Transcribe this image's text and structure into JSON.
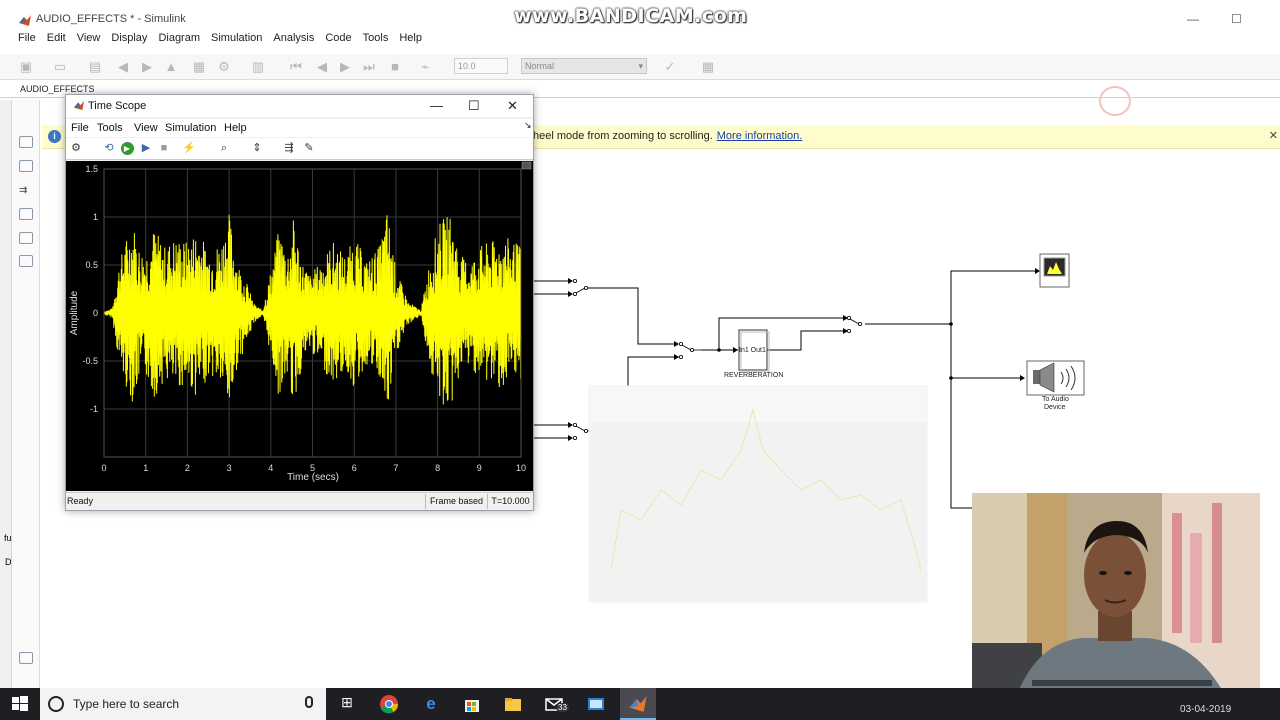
{
  "simulink": {
    "title": "AUDIO_EFFECTS * - Simulink",
    "menu": [
      "File",
      "Edit",
      "View",
      "Display",
      "Diagram",
      "Simulation",
      "Analysis",
      "Code",
      "Tools",
      "Help"
    ],
    "toolbar": {
      "stop_time": "10.0",
      "sim_mode": "Normal"
    },
    "model_tab": "AUDIO_EFFECTS",
    "info_bar": {
      "text": "heel mode from zooming to scrolling.",
      "link": "More information."
    },
    "blocks": {
      "reverb_ports": "In1 Out1",
      "reverb_label": "REVERBERATION",
      "audio_device_label_1": "To Audio",
      "audio_device_label_2": "Device"
    },
    "left_strip_labels": [
      "fu",
      "D"
    ]
  },
  "scope": {
    "title": "Time Scope",
    "menu": [
      "File",
      "Tools",
      "View",
      "Simulation",
      "Help"
    ],
    "status": {
      "ready": "Ready",
      "mode": "Frame based",
      "time": "T=10.000"
    }
  },
  "chart_data": {
    "type": "line",
    "title": "",
    "xlabel": "Time (secs)",
    "ylabel": "Amplitude",
    "xlim": [
      0,
      10
    ],
    "ylim": [
      -1.5,
      1.5
    ],
    "x_ticks": [
      "0",
      "1",
      "2",
      "3",
      "4",
      "5",
      "6",
      "7",
      "8",
      "9",
      "10"
    ],
    "y_ticks": [
      "1.5",
      "1",
      "0.5",
      "0",
      "-0.5",
      "-1"
    ],
    "grid": true,
    "series": [
      {
        "color": "#ffff00",
        "envelope": [
          [
            0.0,
            0.02
          ],
          [
            0.2,
            0.05
          ],
          [
            0.35,
            0.5
          ],
          [
            0.5,
            0.75
          ],
          [
            0.7,
            0.95
          ],
          [
            0.85,
            0.7
          ],
          [
            1.0,
            0.65
          ],
          [
            1.2,
            0.9
          ],
          [
            1.45,
            0.7
          ],
          [
            1.7,
            0.8
          ],
          [
            2.0,
            0.75
          ],
          [
            2.25,
            0.9
          ],
          [
            2.5,
            0.65
          ],
          [
            2.8,
            0.75
          ],
          [
            3.0,
            1.05
          ],
          [
            3.2,
            0.55
          ],
          [
            3.4,
            0.35
          ],
          [
            3.6,
            0.1
          ],
          [
            3.8,
            0.03
          ],
          [
            4.0,
            0.45
          ],
          [
            4.2,
            0.9
          ],
          [
            4.4,
            0.65
          ],
          [
            4.55,
            1.0
          ],
          [
            4.75,
            0.55
          ],
          [
            4.95,
            0.4
          ],
          [
            5.2,
            0.55
          ],
          [
            5.5,
            0.75
          ],
          [
            5.8,
            0.6
          ],
          [
            6.0,
            0.8
          ],
          [
            6.3,
            0.55
          ],
          [
            6.6,
            0.7
          ],
          [
            6.8,
            1.1
          ],
          [
            7.0,
            0.45
          ],
          [
            7.3,
            0.12
          ],
          [
            7.6,
            0.03
          ],
          [
            7.85,
            0.65
          ],
          [
            8.05,
            0.95
          ],
          [
            8.3,
            1.05
          ],
          [
            8.55,
            0.6
          ],
          [
            8.8,
            0.55
          ],
          [
            9.0,
            0.7
          ],
          [
            9.3,
            0.75
          ],
          [
            9.6,
            0.8
          ],
          [
            9.85,
            0.75
          ],
          [
            10.0,
            0.7
          ]
        ]
      }
    ]
  },
  "taskbar": {
    "search_placeholder": "Type here to search",
    "clock_date": "03-04-2019",
    "mail_badge": "33"
  }
}
